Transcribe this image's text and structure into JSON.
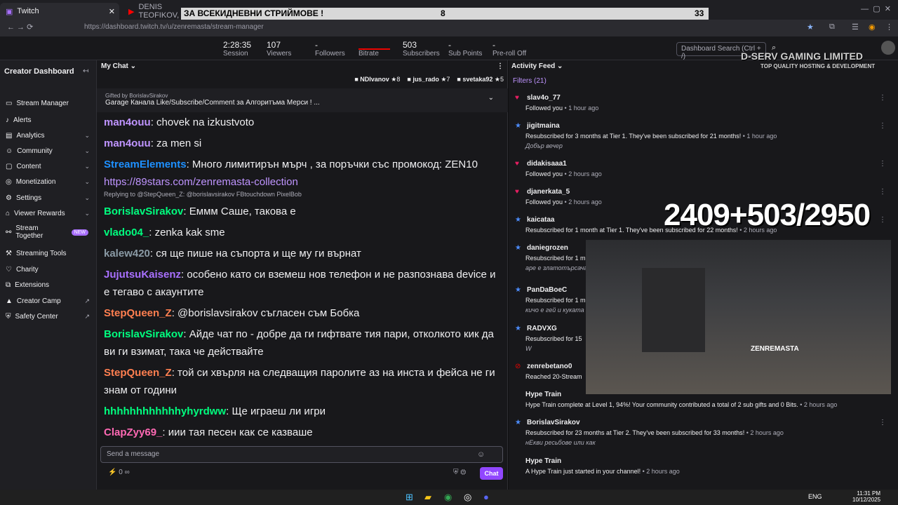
{
  "browser": {
    "tabs": [
      {
        "label": "Twitch"
      },
      {
        "label": "DENIS TEOFIKOV,"
      }
    ],
    "url": "https://dashboard.twitch.tv/u/zenremasta/stream-manager"
  },
  "banner": {
    "text": "ЗА ВСЕКИДНЕВНИ СТРИЙМОВЕ !",
    "left_number": "8",
    "right_number": "33"
  },
  "stats": [
    {
      "value": "2:28:35",
      "label": "Session"
    },
    {
      "value": "107",
      "label": "Viewers"
    },
    {
      "value": "-",
      "label": "Followers"
    },
    {
      "value": "",
      "label": "Bitrate"
    },
    {
      "value": "503",
      "label": "Subscribers"
    },
    {
      "value": "-",
      "label": "Sub Points"
    },
    {
      "value": "-",
      "label": "Pre-roll Off"
    }
  ],
  "dashboard_search": "Dashboard Search (Ctrl + /)",
  "sidebar": {
    "title": "Creator Dashboard",
    "items": [
      {
        "label": "Stream Manager"
      },
      {
        "label": "Alerts"
      },
      {
        "label": "Analytics"
      },
      {
        "label": "Community"
      },
      {
        "label": "Content"
      },
      {
        "label": "Monetization"
      },
      {
        "label": "Settings"
      },
      {
        "label": "Viewer Rewards"
      },
      {
        "label": "Stream Together",
        "badge": "NEW"
      },
      {
        "label": "Streaming Tools"
      },
      {
        "label": "Charity"
      },
      {
        "label": "Extensions"
      },
      {
        "label": "Creator Camp"
      },
      {
        "label": "Safety Center"
      }
    ]
  },
  "chat": {
    "title": "My Chat",
    "pinned_users": [
      {
        "name": "NDIvanov",
        "count": "8"
      },
      {
        "name": "jus_rado",
        "count": "7"
      },
      {
        "name": "svetaka92",
        "count": "5"
      }
    ],
    "pinned_message": "Gifted by BorislavSirakov",
    "pinned_text": "Garage Канала Like/Subscribe/Comment за Алгоритъма Мерси ! ...",
    "messages": [
      {
        "user": "man4ouu",
        "text": "chovek na izkustvoto",
        "color": "#bf94ff"
      },
      {
        "user": "man4ouu",
        "text": "za men si",
        "color": "#bf94ff"
      },
      {
        "user": "StreamElements",
        "text": "Много лимитирън мърч , за поръчки със промокод: ZEN10",
        "link": "https://89stars.com/zenremasta-collection",
        "color": "#1e90ff"
      },
      {
        "reply": "Replying to @StepQueen_Z: @borislavsirakov FBtouchdown PixelBob"
      },
      {
        "user": "BorislavSirakov",
        "text": "Еммм Саше, такова е",
        "color": "#00ff7f"
      },
      {
        "user": "vlado04_",
        "text": "zenka kak sme",
        "color": "#00ff7f"
      },
      {
        "user": "kalew420",
        "text": "ся ще пише на съпорта и ще му ги върнат",
        "color": "#8a9aa5"
      },
      {
        "user": "JujutsuKaisenz",
        "text": "особено като си вземеш нов телефон и не разпознава device и е тегаво с акаунтите",
        "color": "#a970ff"
      },
      {
        "user": "StepQueen_Z",
        "text": "@borislavsirakov съгласен съм Бобка",
        "color": "#ff7f50"
      },
      {
        "user": "BorislavSirakov",
        "text": "Айде чат по - добре да ги гифтвате тия пари, отколкото кик да ви ги взимат, така че действайте",
        "color": "#00ff7f"
      },
      {
        "user": "StepQueen_Z",
        "text": "той си хвърля на следващия паролите аз на инста и фейса не ги знам от години",
        "color": "#ff7f50"
      },
      {
        "user": "hhhhhhhhhhhhyhyrdww",
        "text": "Ще играеш ли игри",
        "color": "#00ff7f"
      },
      {
        "user": "ClapZyy69_",
        "text": "иии тая песен как се казваше",
        "color": "#ff69b4"
      }
    ],
    "input_placeholder": "Send a message",
    "points": "0",
    "chat_button": "Chat"
  },
  "activity": {
    "title": "Activity Feed",
    "filters": "Filters (21)",
    "items": [
      {
        "name": "slav4o_77",
        "desc": "Followed you",
        "time": "1 hour ago",
        "icon": "heart"
      },
      {
        "name": "jigitmaina",
        "desc": "Resubscribed for 3 months at Tier 1. They've been subscribed for 21 months!",
        "time": "1 hour ago",
        "sub": "Добър вечер",
        "icon": "star"
      },
      {
        "name": "didakisaaa1",
        "desc": "Followed you",
        "time": "2 hours ago",
        "icon": "heart"
      },
      {
        "name": "djanerkata_5",
        "desc": "Followed you",
        "time": "2 hours ago",
        "icon": "heart"
      },
      {
        "name": "kaicataa",
        "desc": "Resubscribed for 1 month at Tier 1. They've been subscribed for 22 months!",
        "time": "2 hours ago",
        "icon": "star"
      },
      {
        "name": "daniegrozen",
        "desc": "Resubscribed for 1 m",
        "time": "",
        "sub": "аре е златотърсача",
        "icon": "star"
      },
      {
        "name": "PanDaBoeC",
        "desc": "Resubscribed for 1 m",
        "time": "",
        "sub": "кичо е гей и куката",
        "icon": "star"
      },
      {
        "name": "RADVXG",
        "desc": "Resubscribed for 15",
        "time": "",
        "sub": "W",
        "icon": "star"
      },
      {
        "name": "zenrebetano0",
        "desc": "Reached 20-Stream",
        "time": "",
        "icon": "badge"
      },
      {
        "name": "Hype Train",
        "desc": "Hype Train complete at Level 1, 94%! Your community contributed a total of 2 sub gifts and 0 Bits.",
        "time": "2 hours ago",
        "icon": "train"
      },
      {
        "name": "BorislavSirakov",
        "desc": "Resubscribed for 23 months at Tier 2. They've been subscribed for 33 months!",
        "time": "2 hours ago",
        "sub": "нЕкви ресьбове или как",
        "icon": "star"
      },
      {
        "name": "Hype Train",
        "desc": "A Hype Train just started in your channel!",
        "time": "2 hours ago",
        "icon": "train"
      }
    ]
  },
  "overlay": {
    "counter": "2409+503/2950",
    "brand": "D-SERV GAMING LIMITED",
    "brand_sub": "TOP QUALITY HOSTING & DEVELOPMENT",
    "cam_sign": "ZENREMASTA"
  },
  "taskbar": {
    "lang": "ENG",
    "time": "11:31 PM",
    "date": "10/12/2025"
  },
  "colors": {
    "accent": "#9147ff",
    "bg": "#0e0e10",
    "panel": "#18181b"
  }
}
